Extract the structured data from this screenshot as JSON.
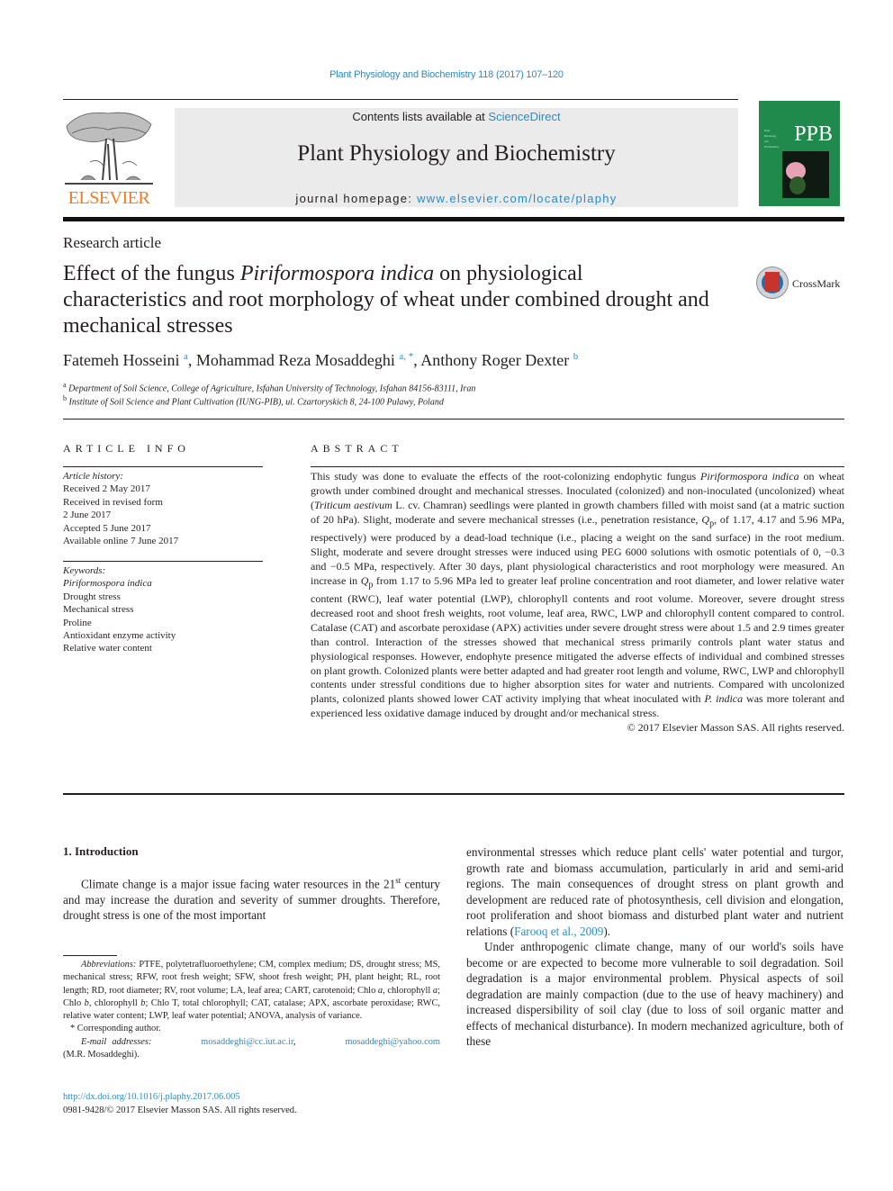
{
  "header": {
    "citation": "Plant Physiology and Biochemistry 118 (2017) 107–120",
    "publisher_logo_text": "ELSEVIER",
    "contents_prefix": "Contents lists available at ",
    "contents_link": "ScienceDirect",
    "journal_title": "Plant Physiology and Biochemistry",
    "homepage_prefix": "journal homepage: ",
    "homepage_link": "www.elsevier.com/locate/plaphy",
    "cover_abbrev": "PPB",
    "cover_lines": [
      "Plant",
      "Physiology",
      "and",
      "Biochemistry"
    ],
    "crossmark_label": "CrossMark"
  },
  "article": {
    "type": "Research article",
    "title_pre": "Effect of the fungus ",
    "title_italic": "Piriformospora indica",
    "title_post": " on physiological characteristics and root morphology of wheat under combined drought and mechanical stresses",
    "authors": [
      {
        "name": "Fatemeh Hosseini",
        "sup": "a"
      },
      {
        "name": "Mohammad Reza Mosaddeghi",
        "sup": "a, *"
      },
      {
        "name": "Anthony Roger Dexter",
        "sup": "b"
      }
    ],
    "affiliations": [
      {
        "sup": "a",
        "text": "Department of Soil Science, College of Agriculture, Isfahan University of Technology, Isfahan 84156-83111, Iran"
      },
      {
        "sup": "b",
        "text": "Institute of Soil Science and Plant Cultivation (IUNG-PIB), ul. Czartoryskich 8, 24-100 Pulawy, Poland"
      }
    ]
  },
  "article_info": {
    "heading": "ARTICLE INFO",
    "history_label": "Article history:",
    "history": [
      "Received 2 May 2017",
      "Received in revised form",
      "2 June 2017",
      "Accepted 5 June 2017",
      "Available online 7 June 2017"
    ],
    "keywords_label": "Keywords:",
    "keywords": [
      "Piriformospora indica",
      "Drought stress",
      "Mechanical stress",
      "Proline",
      "Antioxidant enzyme activity",
      "Relative water content"
    ]
  },
  "abstract": {
    "heading": "ABSTRACT",
    "seg1": "This study was done to evaluate the effects of the root-colonizing endophytic fungus ",
    "seg1_it": "Piriformospora indica",
    "seg2": " on wheat growth under combined drought and mechanical stresses. Inoculated (colonized) and non-inoculated (uncolonized) wheat (",
    "seg2_it": "Triticum aestivum",
    "seg3": " L. cv. Chamran) seedlings were planted in growth chambers filled with moist sand (at a matric suction of 20 hPa). Slight, moderate and severe mechanical stresses (i.e., penetration resistance, ",
    "qp1": "Q",
    "qp_sub": "p",
    "seg4": ", of 1.17, 4.17 and 5.96 MPa, respectively) were produced by a dead-load technique (i.e., placing a weight on the sand surface) in the root medium. Slight, moderate and severe drought stresses were induced using PEG 6000 solutions with osmotic potentials of 0, −0.3 and −0.5 MPa, respectively. After 30 days, plant physiological characteristics and root morphology were measured. An increase in ",
    "seg5": " from 1.17 to 5.96 MPa led to greater leaf proline concentration and root diameter, and lower relative water content (RWC), leaf water potential (LWP), chlorophyll contents and root volume. Moreover, severe drought stress decreased root and shoot fresh weights, root volume, leaf area, RWC, LWP and chlorophyll content compared to control. Catalase (CAT) and ascorbate peroxidase (APX) activities under severe drought stress were about 1.5 and 2.9 times greater than control. Interaction of the stresses showed that mechanical stress primarily controls plant water status and physiological responses. However, endophyte presence mitigated the adverse effects of individual and combined stresses on plant growth. Colonized plants were better adapted and had greater root length and volume, RWC, LWP and chlorophyll contents under stressful conditions due to higher absorption sites for water and nutrients. Compared with uncolonized plants, colonized plants showed lower CAT activity implying that wheat inoculated with ",
    "seg5_it": "P. indica",
    "seg6": " was more tolerant and experienced less oxidative damage induced by drought and/or mechanical stress.",
    "copyright": "© 2017 Elsevier Masson SAS. All rights reserved."
  },
  "introduction": {
    "heading": "1.  Introduction",
    "p1_a": "Climate change is a major issue facing water resources in the 21",
    "p1_sup": "st",
    "p1_b": " century and may increase the duration and severity of summer droughts. Therefore, drought stress is one of the most important",
    "p1_cont": "environmental stresses which reduce plant cells' water potential and turgor, growth rate and biomass accumulation, particularly in arid and semi-arid regions. The main consequences of drought stress on plant growth and development are reduced rate of photosynthesis, cell division and elongation, root proliferation and shoot biomass and disturbed plant water and nutrient relations (",
    "p1_ref": "Farooq et al., 2009",
    "p1_end": ").",
    "p2": "Under anthropogenic climate change, many of our world's soils have become or are expected to become more vulnerable to soil degradation. Soil degradation is a major environmental problem. Physical aspects of soil degradation are mainly compaction (due to the use of heavy machinery) and increased dispersibility of soil clay (due to loss of soil organic matter and effects of mechanical disturbance). In modern mechanized agriculture, both of these"
  },
  "footnotes": {
    "abbrev_label": "Abbreviations:",
    "abbrev_a": " PTFE, polytetrafluoroethylene; CM, complex medium; DS, drought stress; MS, mechanical stress; RFW, root fresh weight; SFW, shoot fresh weight; PH, plant height; RL, root length; RD, root diameter; RV, root volume; LA, leaf area; CART, carotenoid; Chlo ",
    "abbrev_a_it": "a",
    "abbrev_b": ", chlorophyll ",
    "abbrev_b_it": "a",
    "abbrev_c": "; Chlo ",
    "abbrev_c_it": "b",
    "abbrev_d": ", chlorophyll ",
    "abbrev_d_it": "b",
    "abbrev_e": "; Chlo T, total chlorophyll; CAT, catalase; APX, ascorbate peroxidase; RWC, relative water content; LWP, leaf water potential; ANOVA, analysis of variance.",
    "corresponding": "* Corresponding author.",
    "email_label": "E-mail addresses:",
    "email1": "mosaddeghi@cc.iut.ac.ir",
    "email2": "mosaddeghi@yahoo.com",
    "email_owner": "(M.R. Mosaddeghi).",
    "doi": "http://dx.doi.org/10.1016/j.plaphy.2017.06.005",
    "issn": "0981-9428/© 2017 Elsevier Masson SAS. All rights reserved."
  }
}
